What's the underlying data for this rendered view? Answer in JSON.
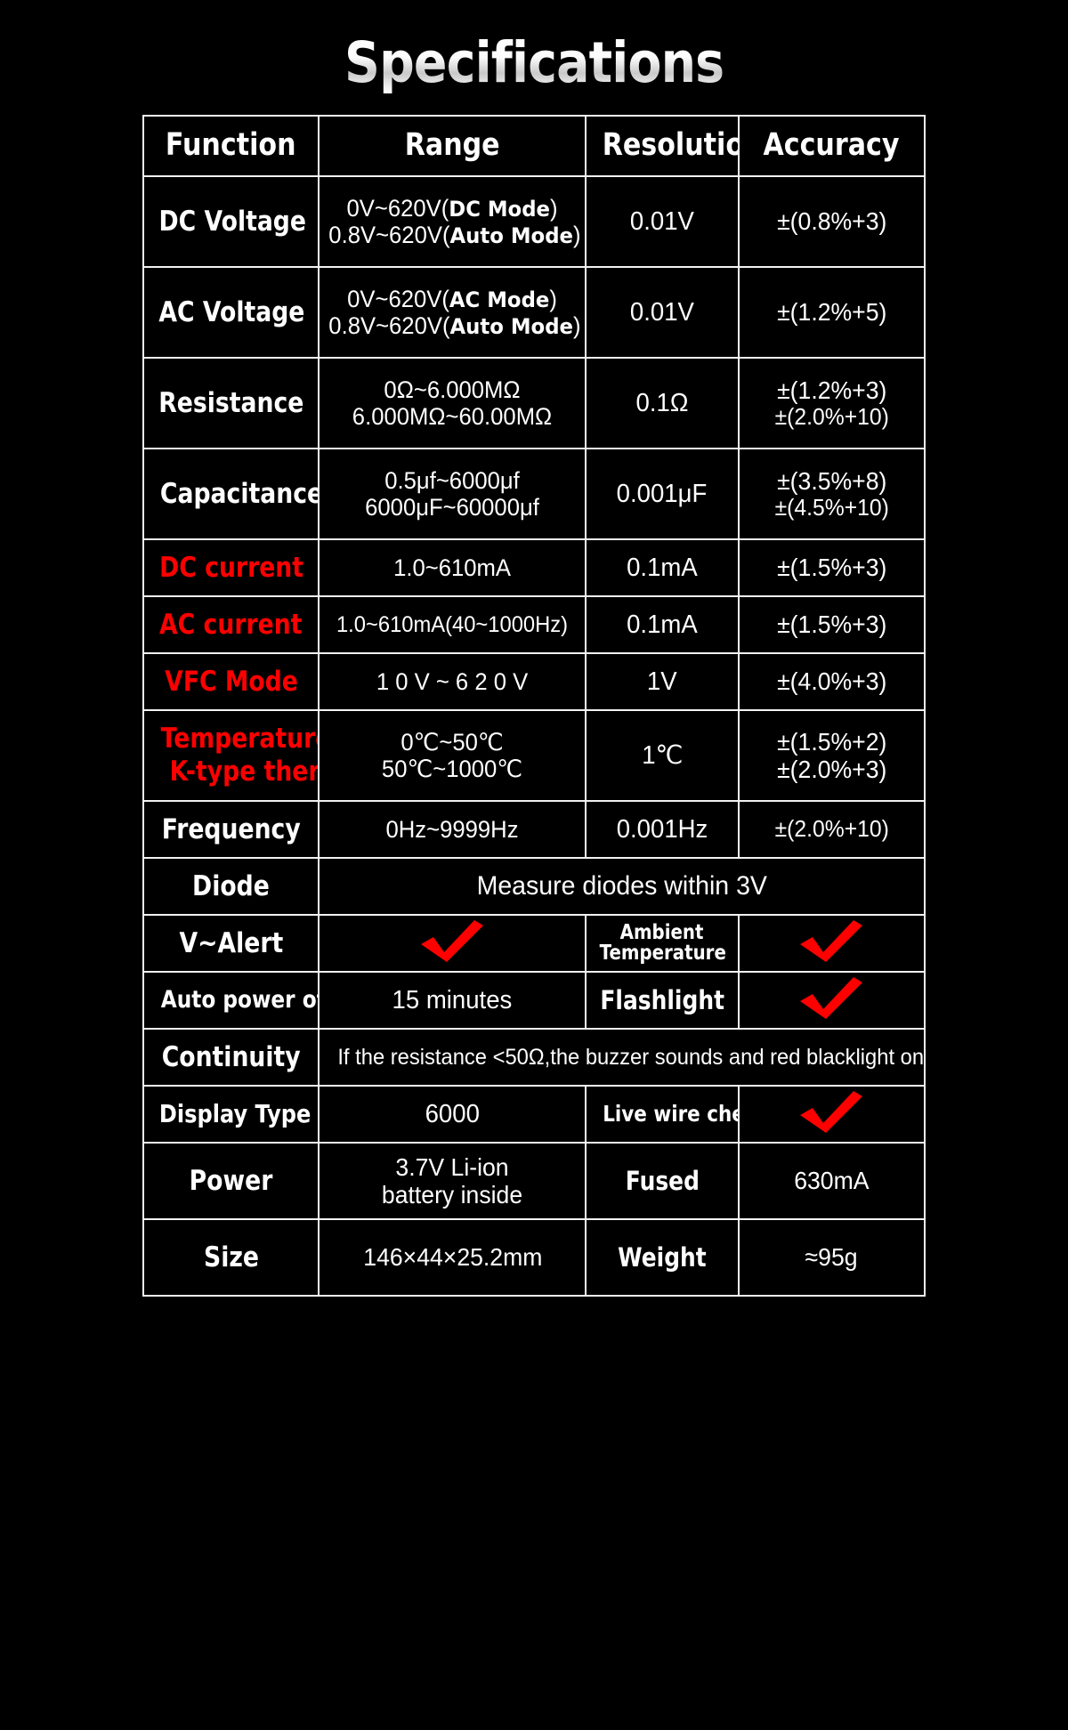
{
  "title": "Specifications",
  "colors": {
    "background": "#000000",
    "text": "#ffffff",
    "accent_red": "#fe0000",
    "border": "#f2f2f2"
  },
  "table": {
    "headers": {
      "function": "Function",
      "range": "Range",
      "resolution": "Resolution",
      "accuracy": "Accuracy"
    },
    "rows": [
      {
        "function": "DC Voltage",
        "function_color": "white",
        "range_line1_num": "0V~620V(",
        "range_line1_mode": "DC Mode",
        "range_line1_end": ")",
        "range_line2_num": "0.8V~620V(",
        "range_line2_mode": "Auto Mode",
        "range_line2_end": ")",
        "resolution": "0.01V",
        "accuracy_line1": "±(0.8%+3)",
        "accuracy_line2": ""
      },
      {
        "function": "AC Voltage",
        "function_color": "white",
        "range_line1_num": "0V~620V(",
        "range_line1_mode": "AC Mode",
        "range_line1_end": ")",
        "range_line2_num": "0.8V~620V(",
        "range_line2_mode": "Auto Mode",
        "range_line2_end": ")",
        "resolution": "0.01V",
        "accuracy_line1": "±(1.2%+5)",
        "accuracy_line2": ""
      },
      {
        "function": "Resistance",
        "function_color": "white",
        "range_line1": "0Ω~6.000MΩ",
        "range_line2": "6.000MΩ~60.00MΩ",
        "resolution": "0.1Ω",
        "accuracy_line1": "±(1.2%+3)",
        "accuracy_line2": "±(2.0%+10)"
      },
      {
        "function": "Capacitance",
        "function_color": "white",
        "range_line1": "0.5μf~6000μf",
        "range_line2": "6000μF~60000μf",
        "resolution": "0.001μF",
        "accuracy_line1": "±(3.5%+8)",
        "accuracy_line2": "±(4.5%+10)"
      },
      {
        "function": "DC current",
        "function_color": "red",
        "range_line1": "1.0~610mA",
        "range_line2": "",
        "resolution": "0.1mA",
        "accuracy_line1": "±(1.5%+3)",
        "accuracy_line2": ""
      },
      {
        "function": "AC current",
        "function_color": "red",
        "range_line1": "1.0~610mA(40~1000Hz)",
        "range_line2": "",
        "resolution": "0.1mA",
        "accuracy_line1": "±(1.5%+3)",
        "accuracy_line2": ""
      },
      {
        "function": "VFC Mode",
        "function_color": "red",
        "range_line1": "1 0 V ~ 6 2 0 V",
        "range_line2": "",
        "resolution": "1V",
        "accuracy_line1": "±(4.0%+3)",
        "accuracy_line2": ""
      },
      {
        "function": "Temperature",
        "function_sub": "K-type thermocouple",
        "function_color": "red",
        "range_line1": "0℃~50℃",
        "range_line2": "50℃~1000℃",
        "resolution": "1℃",
        "accuracy_line1": "±(1.5%+2)",
        "accuracy_line2": "±(2.0%+3)"
      },
      {
        "function": "Frequency",
        "function_color": "white",
        "range_line1": "0Hz~9999Hz",
        "range_line2": "",
        "resolution": "0.001Hz",
        "accuracy_line1": "±(2.0%+10)",
        "accuracy_line2": ""
      }
    ],
    "diode": {
      "label": "Diode",
      "value": "Measure diodes within 3V"
    },
    "valert": {
      "label": "V~Alert",
      "value_icon": "check-icon",
      "right_label_line1": "Ambient",
      "right_label_line2": "Temperature",
      "right_icon": "check-icon"
    },
    "auto_power_off": {
      "label": "Auto power off",
      "value": "15 minutes",
      "right_label": "Flashlight",
      "right_icon": "check-icon"
    },
    "continuity": {
      "label": "Continuity",
      "value": "If the resistance <50Ω,the buzzer sounds and red blacklight on"
    },
    "display_type": {
      "label": "Display Type",
      "value": "6000",
      "right_label": "Live wire check",
      "right_icon": "check-icon"
    },
    "power": {
      "label": "Power",
      "value_line1": "3.7V Li-ion",
      "value_line2": "battery inside",
      "right_label": "Fused",
      "right_value": "630mA"
    },
    "size": {
      "label": "Size",
      "value": "146×44×25.2mm",
      "right_label": "Weight",
      "right_value": "≈95g"
    }
  }
}
